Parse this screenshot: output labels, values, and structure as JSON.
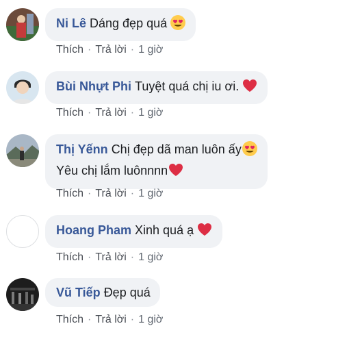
{
  "comments": [
    {
      "author": "Ni Lê",
      "text": "Dáng đẹp quá",
      "emoji": "heart-eyes",
      "actions": {
        "like": "Thích",
        "reply": "Trả lời",
        "time": "1 giờ"
      }
    },
    {
      "author": "Bùi Nhựt Phi",
      "text": "Tuyệt quá chị iu ơi.",
      "emoji": "red-heart",
      "actions": {
        "like": "Thích",
        "reply": "Trả lời",
        "time": "1 giờ"
      }
    },
    {
      "author": "Thị Yếnn",
      "text": "Chị đẹp dã man luôn ấy",
      "text2": "Yêu chị lắm luônnnn",
      "emoji": "heart-eyes",
      "emoji2": "red-heart",
      "actions": {
        "like": "Thích",
        "reply": "Trả lời",
        "time": "1 giờ"
      }
    },
    {
      "author": "Hoang Pham",
      "text": "Xinh quá ạ",
      "emoji": "red-heart",
      "actions": {
        "like": "Thích",
        "reply": "Trả lời",
        "time": "1 giờ"
      }
    },
    {
      "author": "Vũ Tiếp",
      "text": "Đẹp quá",
      "actions": {
        "like": "Thích",
        "reply": "Trả lời",
        "time": "1 giờ"
      }
    }
  ],
  "colors": {
    "author": "#385898",
    "bubble": "#f0f2f5",
    "meta": "#606770",
    "heart": "#e0245e"
  }
}
